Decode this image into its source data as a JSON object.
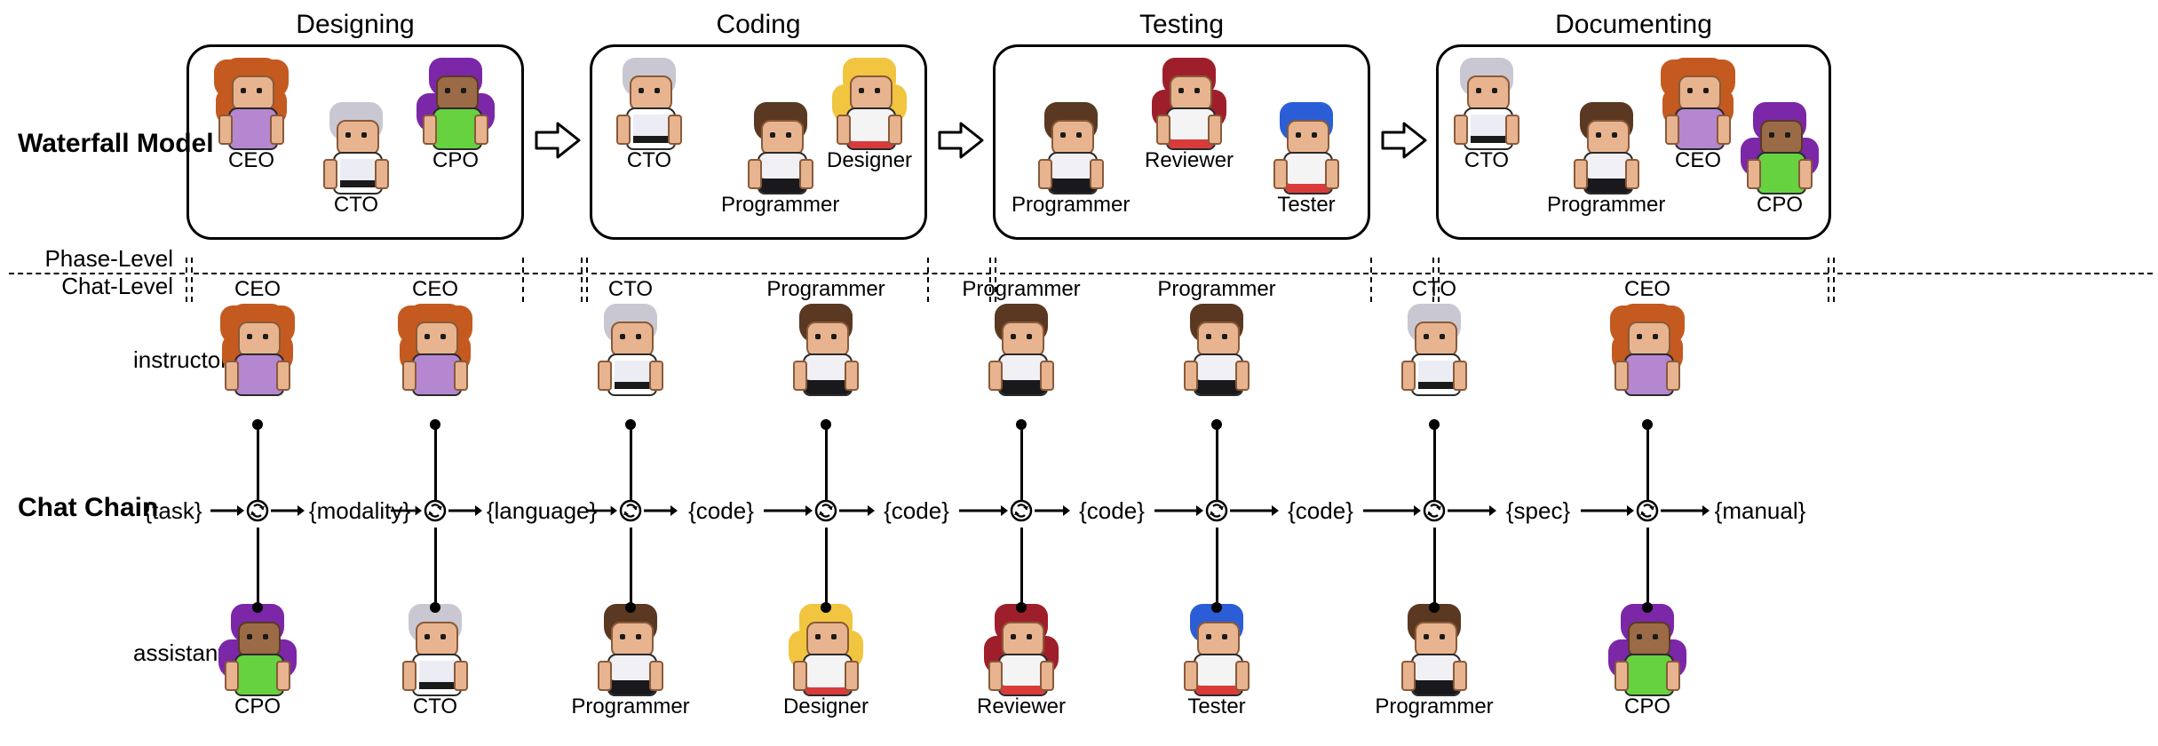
{
  "labels": {
    "waterfall": "Waterfall Model",
    "chat_chain": "Chat Chain",
    "phase_level": "Phase-Level",
    "chat_level": "Chat-Level",
    "instructor": "instructor",
    "assistant": "assistant"
  },
  "phases": [
    {
      "title": "Designing",
      "members": [
        "CEO",
        "CTO",
        "CPO"
      ]
    },
    {
      "title": "Coding",
      "members": [
        "CTO",
        "Programmer",
        "Designer"
      ]
    },
    {
      "title": "Testing",
      "members": [
        "Programmer",
        "Reviewer",
        "Tester"
      ]
    },
    {
      "title": "Documenting",
      "members": [
        "CTO",
        "Programmer",
        "CEO",
        "CPO"
      ]
    }
  ],
  "chain_tokens": [
    "{task}",
    "{modality}",
    "{language}",
    "{code}",
    "{code}",
    "{code}",
    "{code}",
    "{spec}",
    "{manual}"
  ],
  "chain_nodes": [
    {
      "instructor": "CEO",
      "assistant": "CPO"
    },
    {
      "instructor": "CEO",
      "assistant": "CTO"
    },
    {
      "instructor": "CTO",
      "assistant": "Programmer"
    },
    {
      "instructor": "Programmer",
      "assistant": "Designer"
    },
    {
      "instructor": "Programmer",
      "assistant": "Reviewer"
    },
    {
      "instructor": "Programmer",
      "assistant": "Tester"
    },
    {
      "instructor": "CTO",
      "assistant": "Programmer"
    },
    {
      "instructor": "CEO",
      "assistant": "CPO"
    }
  ]
}
